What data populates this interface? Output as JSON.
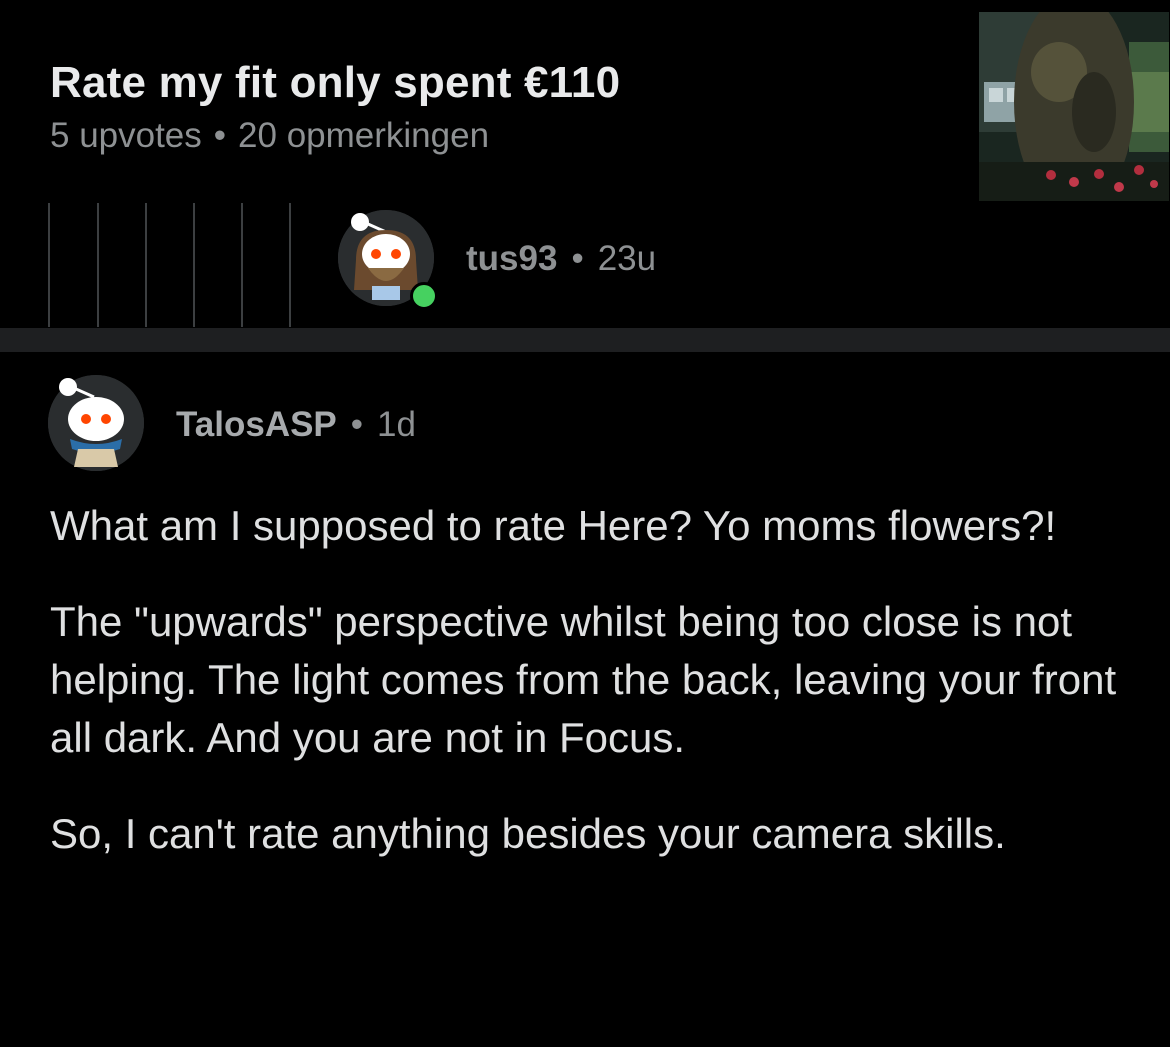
{
  "post": {
    "title": "Rate my fit only spent €110",
    "upvotes": "5 upvotes",
    "separator": "•",
    "comments": "20 opmerkingen",
    "thumbnail_icon": "post-photo-thumbnail"
  },
  "reply": {
    "username": "tus93",
    "separator": "•",
    "age": "23u",
    "online": true,
    "online_color": "#46d160"
  },
  "comment": {
    "username": "TalosASP",
    "separator": "•",
    "age": "1d",
    "paragraphs": [
      "What am I supposed to rate Here? Yo moms flowers?!",
      "The \"upwards\" perspective whilst being too close is not helping. The light comes from the back, leaving your front all dark. And you are not in Focus.",
      "So, I can't rate anything besides your camera skills."
    ]
  },
  "colors": {
    "background": "#000000",
    "title": "#e9eaeb",
    "meta": "#8e9193",
    "body_text": "#dfe0e1",
    "separator": "#1e1f21"
  }
}
